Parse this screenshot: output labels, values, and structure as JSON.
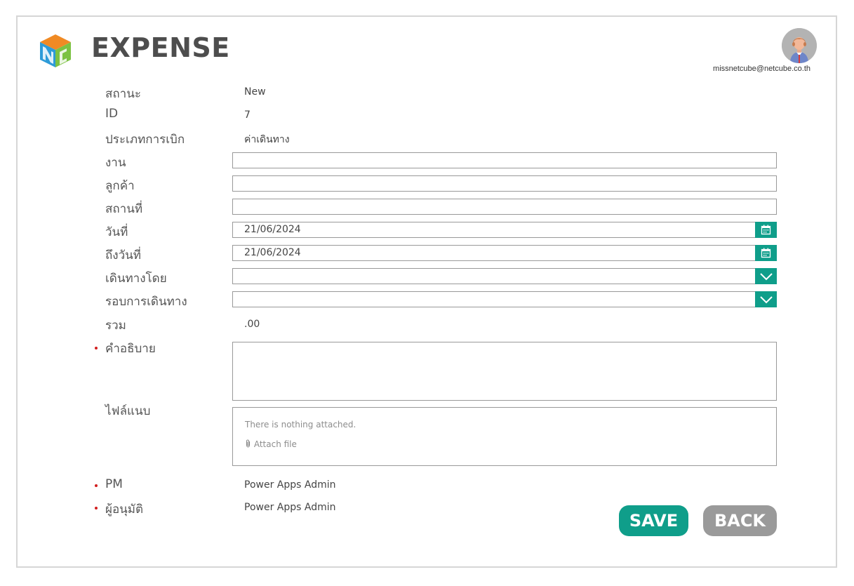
{
  "header": {
    "title": "EXPENSE",
    "user_email": "missnetcube@netcube.co.th",
    "logo_icon": "netcube-logo",
    "avatar_icon": "user-avatar"
  },
  "form": {
    "status_label": "สถานะ",
    "status_value": "New",
    "id_label": "ID",
    "id_value": "7",
    "type_label": "ประเภทการเบิก",
    "type_value": "ค่าเดินทาง",
    "job_label": "งาน",
    "job_value": "",
    "customer_label": "ลูกค้า",
    "customer_value": "",
    "place_label": "สถานที่",
    "place_value": "",
    "date_label": "วันที่",
    "date_value": "21/06/2024",
    "to_date_label": "ถึงวันที่",
    "to_date_value": "21/06/2024",
    "travel_by_label": "เดินทางโดย",
    "travel_by_value": "",
    "trip_label": "รอบการเดินทาง",
    "trip_value": "",
    "total_label": "รวม",
    "total_value": ".00",
    "description_label": "คำอธิบาย",
    "description_value": "",
    "attachments_label": "ไฟล์แนบ",
    "attachments_empty": "There is nothing attached.",
    "attach_file": "Attach file",
    "pm_label": "PM",
    "pm_value": "Power Apps Admin",
    "approver_label": "ผู้อนุมัติ",
    "approver_value": "Power Apps Admin"
  },
  "actions": {
    "save_label": "SAVE",
    "back_label": "BACK"
  },
  "colors": {
    "accent": "#0f9e8a",
    "secondary_button": "#9a9a9a",
    "required": "#d21f1f"
  }
}
